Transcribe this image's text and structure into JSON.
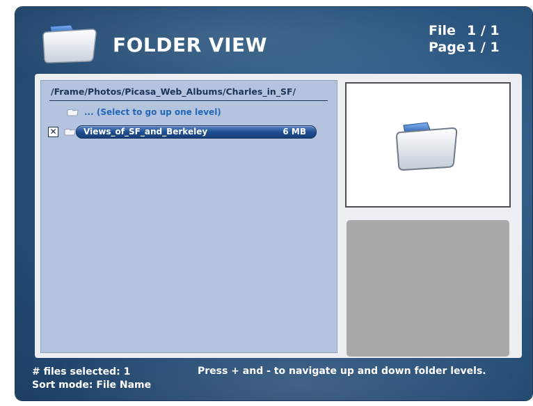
{
  "header": {
    "title": "FOLDER VIEW",
    "file_label": "File",
    "file_value": "1 / 1",
    "page_label": "Page",
    "page_value": "1 / 1",
    "icon": "folder-icon"
  },
  "browser": {
    "path": "/Frame/Photos/Picasa_Web_Albums/Charles_in_SF/",
    "up_level_label": "... (Select to go up one level)",
    "items": [
      {
        "name": "Views_of_SF_and_Berkeley",
        "size": "6 MB",
        "checked_mark": "✕",
        "selected": true
      }
    ]
  },
  "footer": {
    "files_selected": "# files selected: 1",
    "sort_mode": "Sort mode: File Name",
    "hint": "Press + and - to navigate up and down folder levels."
  },
  "colors": {
    "accent": "#1f4f91",
    "background": "#2b557f",
    "list_background": "#b4c4de",
    "info_box": "#a9a9a9"
  }
}
